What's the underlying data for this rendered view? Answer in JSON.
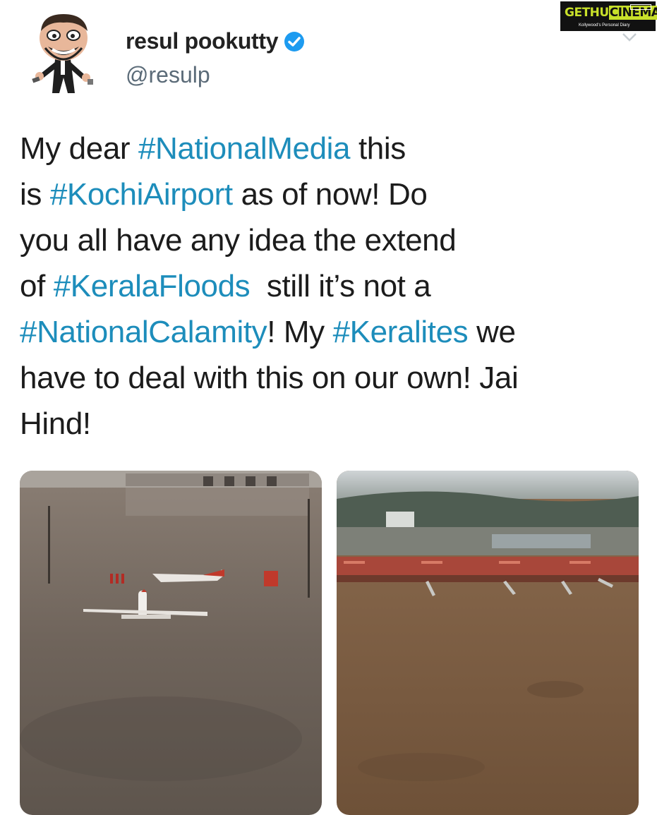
{
  "user": {
    "display_name": "resul pookutty",
    "handle": "@resulp",
    "verified": true,
    "avatar_icon": "caricature-avatar-icon"
  },
  "watermark": {
    "brand_left": "GETHU",
    "brand_right": "CINEMA",
    "tagline": "Kollywood's Personal Diary"
  },
  "tweet": {
    "parts": [
      {
        "text": "My dear ",
        "tag": false
      },
      {
        "text": "#NationalMedia",
        "tag": true
      },
      {
        "text": " this\nis ",
        "tag": false
      },
      {
        "text": "#KochiAirport",
        "tag": true
      },
      {
        "text": " as of now! Do\nyou all have any idea the extend\nof ",
        "tag": false
      },
      {
        "text": "#KeralaFloods",
        "tag": true
      },
      {
        "text": "  still it’s not a\n",
        "tag": false
      },
      {
        "text": "#NationalCalamity",
        "tag": true
      },
      {
        "text": "! My ",
        "tag": false
      },
      {
        "text": "#Keralites",
        "tag": true
      },
      {
        "text": " we\nhave to deal with this on our own! Jai\nHind!",
        "tag": false
      }
    ]
  },
  "media": [
    {
      "name": "flooded-runway-photo",
      "description_icon": "flooded-airport-apron-image"
    },
    {
      "name": "flooded-terminal-aerial-photo",
      "description_icon": "flooded-airport-aerial-image"
    }
  ],
  "colors": {
    "hashtag": "#1d8dbb",
    "verified": "#1d9bf0",
    "text": "#1c1c1c",
    "handle": "#5b6b78"
  }
}
